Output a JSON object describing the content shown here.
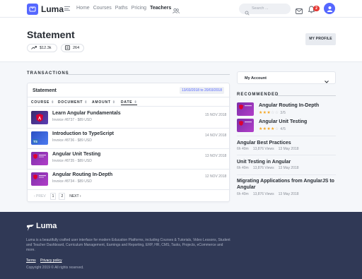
{
  "app": {
    "name": "Luma"
  },
  "nav": {
    "links": [
      {
        "label": "Home",
        "active": false
      },
      {
        "label": "Courses",
        "active": false
      },
      {
        "label": "Paths",
        "active": false
      },
      {
        "label": "Pricing",
        "active": false
      },
      {
        "label": "Teachers",
        "active": true
      }
    ],
    "search_placeholder": "Search ...",
    "notification_count": "2"
  },
  "header": {
    "title": "Statement",
    "stats": [
      {
        "icon": "trending-up-icon",
        "value": "$12.3k"
      },
      {
        "icon": "receipt-icon",
        "value": "264"
      }
    ],
    "profile_button": "MY PROFILE"
  },
  "transactions": {
    "section_title": "TRANSACTIONS",
    "card_title": "Statement",
    "date_range": "13/03/2018 to 20/03/2018",
    "columns": [
      "COURSE",
      "DOCUMENT",
      "AMOUNT",
      "DATE"
    ],
    "rows": [
      {
        "title": "Learn Angular Fundamentals",
        "sub": "Invoice #8737 - $89 USD",
        "date": "15 NOV 2018",
        "thumb": "angular"
      },
      {
        "title": "Introduction to TypeScript",
        "sub": "Invoice #8736 - $89 USD",
        "date": "14 NOV 2018",
        "thumb": "typescript"
      },
      {
        "title": "Angular Unit Testing",
        "sub": "Invoice #8735 - $89 USD",
        "date": "13 NOV 2018",
        "thumb": "angular-purple"
      },
      {
        "title": "Angular Routing In-Depth",
        "sub": "Invoice #8734 - $89 USD",
        "date": "12 NOV 2018",
        "thumb": "angular-purple"
      }
    ],
    "pager": {
      "prev": "‹ PREV",
      "pages": [
        "1",
        "2"
      ],
      "next": "NEXT ›"
    }
  },
  "sidebar": {
    "account_select": "My Account",
    "recommended_title": "RECOMMENDED",
    "rated": [
      {
        "title": "Angular Routing In-Depth",
        "rating": 3,
        "rating_text": "3/5"
      },
      {
        "title": "Angular Unit Testing",
        "rating": 4,
        "rating_text": "4/5"
      }
    ],
    "plain": [
      {
        "title": "Angular Best Practices",
        "duration": "6h 40m",
        "views": "13,876 Views",
        "date": "13 May 2018"
      },
      {
        "title": "Unit Testing in Angular",
        "duration": "6h 40m",
        "views": "13,876 Views",
        "date": "13 May 2018"
      },
      {
        "title": "Migrating Applications from AngularJS to Angular",
        "duration": "6h 40m",
        "views": "13,876 Views",
        "date": "13 May 2018"
      }
    ]
  },
  "footer": {
    "brand": "Luma",
    "description": "Luma is a beautifully crafted user interface for modern Education Platforms, including Courses & Tutorials, Video Lessons, Student and Teacher Dashboard, Curriculum Management, Earnings and Reporting, ERP, HR, CMS, Tasks, Projects, eCommerce and more.",
    "links": [
      "Terms",
      "Privacy policy"
    ],
    "copyright": "Copyright 2019 © All rights reserved."
  },
  "colors": {
    "primary": "#5567ff",
    "footer_bg": "#303956",
    "star": "#f5a623",
    "badge": "#e53935"
  }
}
